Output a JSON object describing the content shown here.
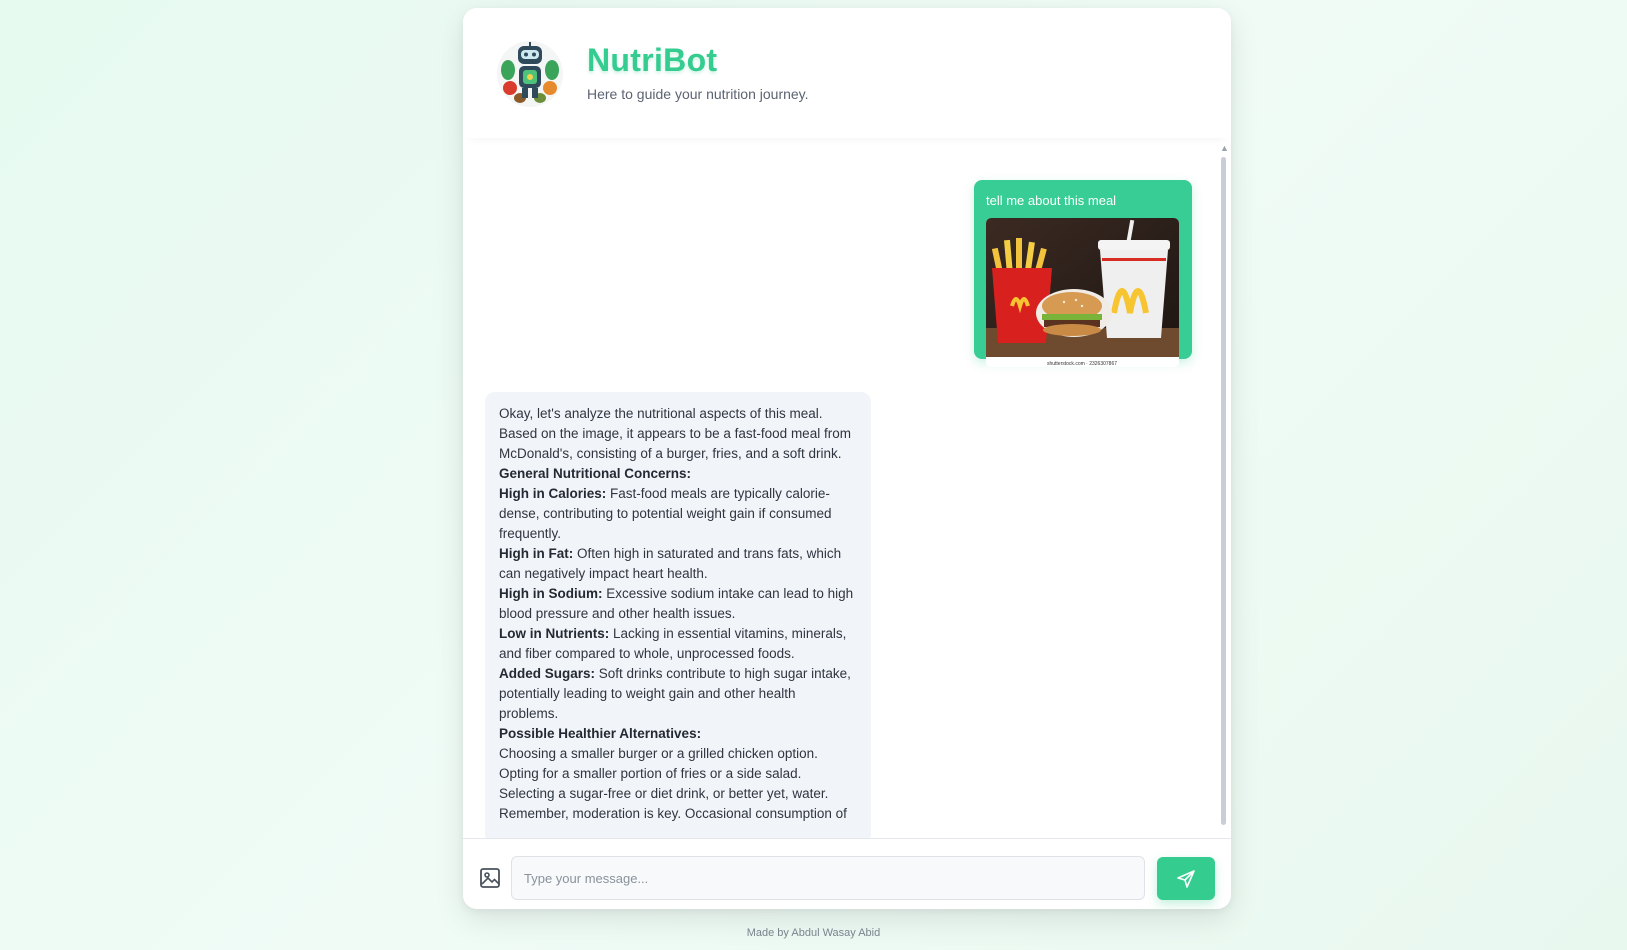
{
  "header": {
    "title": "NutriBot",
    "subtitle": "Here to guide your nutrition journey."
  },
  "messages": {
    "user": {
      "text": "tell me about this meal",
      "image_caption": "shutterstock.com · 2326307867"
    },
    "bot": {
      "intro": "Okay, let's analyze the nutritional aspects of this meal. Based on the image, it appears to be a fast-food meal from McDonald's, consisting of a burger, fries, and a soft drink.",
      "concerns_heading": "General Nutritional Concerns:",
      "items": [
        {
          "label": "High in Calories:",
          "text": " Fast-food meals are typically calorie-dense, contributing to potential weight gain if consumed frequently."
        },
        {
          "label": "High in Fat:",
          "text": " Often high in saturated and trans fats, which can negatively impact heart health."
        },
        {
          "label": "High in Sodium:",
          "text": " Excessive sodium intake can lead to high blood pressure and other health issues."
        },
        {
          "label": "Low in Nutrients:",
          "text": " Lacking in essential vitamins, minerals, and fiber compared to whole, unprocessed foods."
        },
        {
          "label": "Added Sugars:",
          "text": " Soft drinks contribute to high sugar intake, potentially leading to weight gain and other health problems."
        }
      ],
      "alternatives_heading": "Possible Healthier Alternatives:",
      "alternatives": [
        "Choosing a smaller burger or a grilled chicken option.",
        "Opting for a smaller portion of fries or a side salad.",
        "Selecting a sugar-free or diet drink, or better yet, water.",
        "Remember, moderation is key. Occasional consumption of"
      ]
    }
  },
  "input": {
    "placeholder": "Type your message..."
  },
  "footer": {
    "credit": "Made by Abdul Wasay Abid"
  },
  "colors": {
    "accent": "#34cc8f",
    "user_bubble": "#38cd94",
    "bot_bubble": "#f1f4f8"
  },
  "icons": {
    "logo": "robot-vegetables-logo",
    "upload": "image-icon",
    "send": "send-icon"
  }
}
